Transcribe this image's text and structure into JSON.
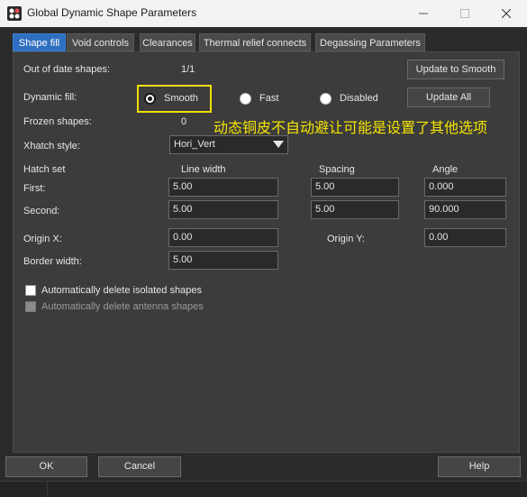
{
  "window": {
    "title": "Global Dynamic Shape Parameters"
  },
  "tabs": [
    {
      "label": "Shape fill",
      "active": true
    },
    {
      "label": "Void controls",
      "active": false
    },
    {
      "label": "Clearances",
      "active": false
    },
    {
      "label": "Thermal relief connects",
      "active": false
    },
    {
      "label": "Degassing Parameters",
      "active": false
    }
  ],
  "shape_fill": {
    "out_of_date_label": "Out of date shapes:",
    "out_of_date_value": "1/1",
    "update_to_smooth_label": "Update to Smooth",
    "dynamic_fill_label": "Dynamic fill:",
    "radio_smooth": "Smooth",
    "radio_fast": "Fast",
    "radio_disabled": "Disabled",
    "selected_fill": "Smooth",
    "update_all_label": "Update All",
    "frozen_label": "Frozen shapes:",
    "frozen_value": "0",
    "annotation": "动态铜皮不自动避让可能是设置了其他选项",
    "xhatch_label": "Xhatch style:",
    "xhatch_value": "Hori_Vert",
    "hatch_set_label": "Hatch set",
    "col_line_width": "Line width",
    "col_spacing": "Spacing",
    "col_angle": "Angle",
    "first_label": "First:",
    "first_line_width": "5.00",
    "first_spacing": "5.00",
    "first_angle": "0.000",
    "second_label": "Second:",
    "second_line_width": "5.00",
    "second_spacing": "5.00",
    "second_angle": "90.000",
    "origin_x_label": "Origin X:",
    "origin_x_value": "0.00",
    "origin_y_label": "Origin Y:",
    "origin_y_value": "0.00",
    "border_width_label": "Border width:",
    "border_width_value": "5.00",
    "auto_delete_isolated_label": "Automatically delete isolated shapes",
    "auto_delete_isolated_checked": false,
    "auto_delete_antenna_label": "Automatically delete antenna shapes",
    "auto_delete_antenna_checked": false,
    "auto_delete_antenna_enabled": false
  },
  "footer": {
    "ok_label": "OK",
    "cancel_label": "Cancel",
    "help_label": "Help"
  },
  "colors": {
    "accent_tab": "#2f6fc0",
    "highlight": "#f0e000",
    "annotation": "#f5e400"
  }
}
